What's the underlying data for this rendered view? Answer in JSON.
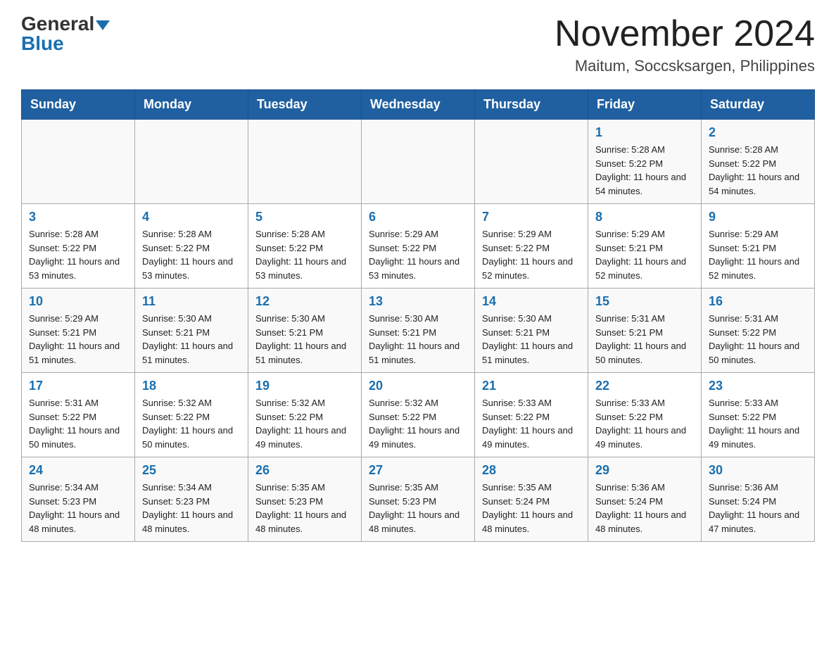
{
  "header": {
    "logo_general": "General",
    "logo_blue": "Blue",
    "month_title": "November 2024",
    "location": "Maitum, Soccsksargen, Philippines"
  },
  "weekdays": [
    "Sunday",
    "Monday",
    "Tuesday",
    "Wednesday",
    "Thursday",
    "Friday",
    "Saturday"
  ],
  "weeks": [
    [
      {
        "day": "",
        "info": ""
      },
      {
        "day": "",
        "info": ""
      },
      {
        "day": "",
        "info": ""
      },
      {
        "day": "",
        "info": ""
      },
      {
        "day": "",
        "info": ""
      },
      {
        "day": "1",
        "info": "Sunrise: 5:28 AM\nSunset: 5:22 PM\nDaylight: 11 hours and 54 minutes."
      },
      {
        "day": "2",
        "info": "Sunrise: 5:28 AM\nSunset: 5:22 PM\nDaylight: 11 hours and 54 minutes."
      }
    ],
    [
      {
        "day": "3",
        "info": "Sunrise: 5:28 AM\nSunset: 5:22 PM\nDaylight: 11 hours and 53 minutes."
      },
      {
        "day": "4",
        "info": "Sunrise: 5:28 AM\nSunset: 5:22 PM\nDaylight: 11 hours and 53 minutes."
      },
      {
        "day": "5",
        "info": "Sunrise: 5:28 AM\nSunset: 5:22 PM\nDaylight: 11 hours and 53 minutes."
      },
      {
        "day": "6",
        "info": "Sunrise: 5:29 AM\nSunset: 5:22 PM\nDaylight: 11 hours and 53 minutes."
      },
      {
        "day": "7",
        "info": "Sunrise: 5:29 AM\nSunset: 5:22 PM\nDaylight: 11 hours and 52 minutes."
      },
      {
        "day": "8",
        "info": "Sunrise: 5:29 AM\nSunset: 5:21 PM\nDaylight: 11 hours and 52 minutes."
      },
      {
        "day": "9",
        "info": "Sunrise: 5:29 AM\nSunset: 5:21 PM\nDaylight: 11 hours and 52 minutes."
      }
    ],
    [
      {
        "day": "10",
        "info": "Sunrise: 5:29 AM\nSunset: 5:21 PM\nDaylight: 11 hours and 51 minutes."
      },
      {
        "day": "11",
        "info": "Sunrise: 5:30 AM\nSunset: 5:21 PM\nDaylight: 11 hours and 51 minutes."
      },
      {
        "day": "12",
        "info": "Sunrise: 5:30 AM\nSunset: 5:21 PM\nDaylight: 11 hours and 51 minutes."
      },
      {
        "day": "13",
        "info": "Sunrise: 5:30 AM\nSunset: 5:21 PM\nDaylight: 11 hours and 51 minutes."
      },
      {
        "day": "14",
        "info": "Sunrise: 5:30 AM\nSunset: 5:21 PM\nDaylight: 11 hours and 51 minutes."
      },
      {
        "day": "15",
        "info": "Sunrise: 5:31 AM\nSunset: 5:21 PM\nDaylight: 11 hours and 50 minutes."
      },
      {
        "day": "16",
        "info": "Sunrise: 5:31 AM\nSunset: 5:22 PM\nDaylight: 11 hours and 50 minutes."
      }
    ],
    [
      {
        "day": "17",
        "info": "Sunrise: 5:31 AM\nSunset: 5:22 PM\nDaylight: 11 hours and 50 minutes."
      },
      {
        "day": "18",
        "info": "Sunrise: 5:32 AM\nSunset: 5:22 PM\nDaylight: 11 hours and 50 minutes."
      },
      {
        "day": "19",
        "info": "Sunrise: 5:32 AM\nSunset: 5:22 PM\nDaylight: 11 hours and 49 minutes."
      },
      {
        "day": "20",
        "info": "Sunrise: 5:32 AM\nSunset: 5:22 PM\nDaylight: 11 hours and 49 minutes."
      },
      {
        "day": "21",
        "info": "Sunrise: 5:33 AM\nSunset: 5:22 PM\nDaylight: 11 hours and 49 minutes."
      },
      {
        "day": "22",
        "info": "Sunrise: 5:33 AM\nSunset: 5:22 PM\nDaylight: 11 hours and 49 minutes."
      },
      {
        "day": "23",
        "info": "Sunrise: 5:33 AM\nSunset: 5:22 PM\nDaylight: 11 hours and 49 minutes."
      }
    ],
    [
      {
        "day": "24",
        "info": "Sunrise: 5:34 AM\nSunset: 5:23 PM\nDaylight: 11 hours and 48 minutes."
      },
      {
        "day": "25",
        "info": "Sunrise: 5:34 AM\nSunset: 5:23 PM\nDaylight: 11 hours and 48 minutes."
      },
      {
        "day": "26",
        "info": "Sunrise: 5:35 AM\nSunset: 5:23 PM\nDaylight: 11 hours and 48 minutes."
      },
      {
        "day": "27",
        "info": "Sunrise: 5:35 AM\nSunset: 5:23 PM\nDaylight: 11 hours and 48 minutes."
      },
      {
        "day": "28",
        "info": "Sunrise: 5:35 AM\nSunset: 5:24 PM\nDaylight: 11 hours and 48 minutes."
      },
      {
        "day": "29",
        "info": "Sunrise: 5:36 AM\nSunset: 5:24 PM\nDaylight: 11 hours and 48 minutes."
      },
      {
        "day": "30",
        "info": "Sunrise: 5:36 AM\nSunset: 5:24 PM\nDaylight: 11 hours and 47 minutes."
      }
    ]
  ]
}
